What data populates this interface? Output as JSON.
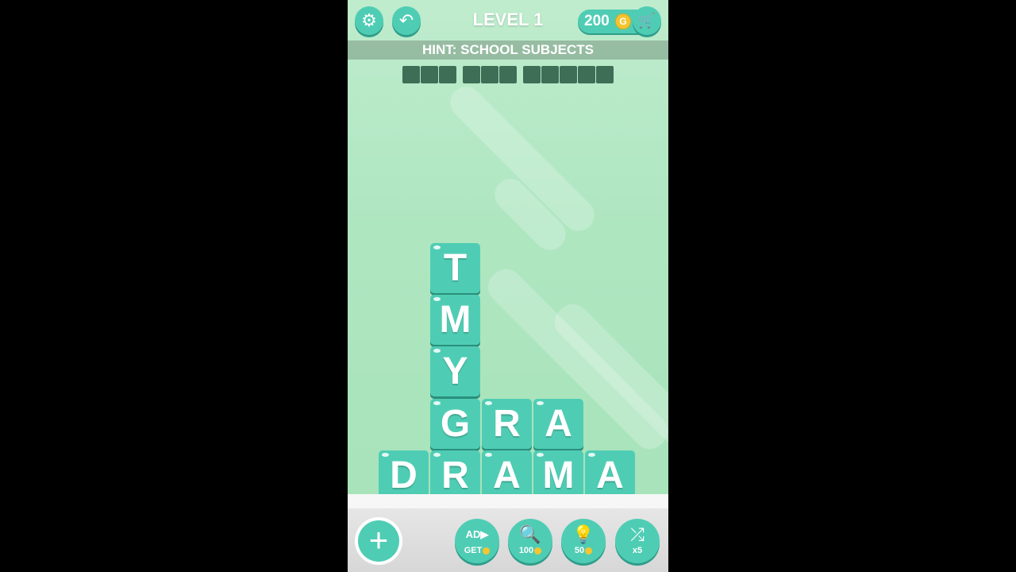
{
  "header": {
    "level_label": "LEVEL 1",
    "coins": "200",
    "coin_symbol": "G"
  },
  "icons": {
    "settings": "⚙",
    "back": "↶",
    "cart": "🛒",
    "add": "+",
    "ad": "AD▶",
    "magnifier": "🔍",
    "bulb": "💡",
    "shuffle": "⤮"
  },
  "hint": {
    "text": "HINT: SCHOOL SUBJECTS"
  },
  "answer_word_lengths": [
    3,
    3,
    5
  ],
  "tiles": [
    "T",
    "M",
    "Y",
    "G",
    "R",
    "A",
    "D",
    "R",
    "A",
    "M",
    "A"
  ],
  "powerups": [
    {
      "icon": "AD▶",
      "label": "GET"
    },
    {
      "icon": "🔍",
      "label": "100"
    },
    {
      "icon": "💡",
      "label": "50"
    },
    {
      "icon": "⤮",
      "label": "x5"
    }
  ],
  "colors": {
    "tile": "#4fcdb4",
    "background": "#aee6c0",
    "coin": "#f4c531"
  }
}
